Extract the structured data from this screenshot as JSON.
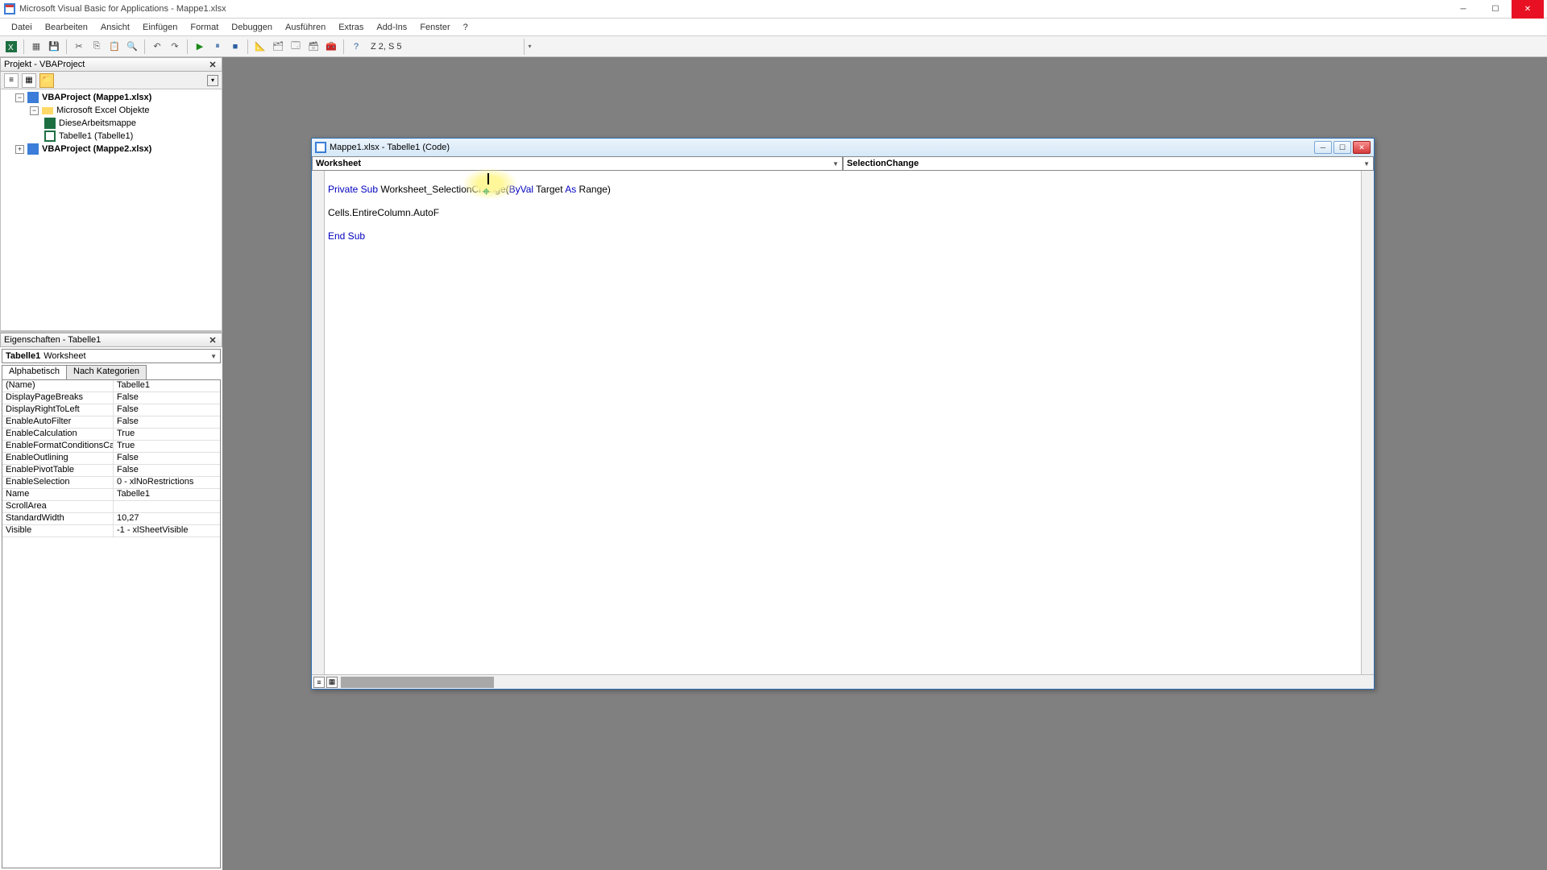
{
  "title": "Microsoft Visual Basic for Applications - Mappe1.xlsx",
  "menu": [
    "Datei",
    "Bearbeiten",
    "Ansicht",
    "Einfügen",
    "Format",
    "Debuggen",
    "Ausführen",
    "Extras",
    "Add-Ins",
    "Fenster",
    "?"
  ],
  "toolbar_pos": "Z 2, S 5",
  "project_panel": {
    "title": "Projekt - VBAProject",
    "tree": {
      "p1": "VBAProject (Mappe1.xlsx)",
      "p1_folder": "Microsoft Excel Objekte",
      "p1_a": "DieseArbeitsmappe",
      "p1_b": "Tabelle1 (Tabelle1)",
      "p2": "VBAProject (Mappe2.xlsx)"
    }
  },
  "props_panel": {
    "title": "Eigenschaften - Tabelle1",
    "combo_name": "Tabelle1",
    "combo_type": "Worksheet",
    "tabs": {
      "a": "Alphabetisch",
      "b": "Nach Kategorien"
    },
    "rows": [
      {
        "n": "(Name)",
        "v": "Tabelle1"
      },
      {
        "n": "DisplayPageBreaks",
        "v": "False"
      },
      {
        "n": "DisplayRightToLeft",
        "v": "False"
      },
      {
        "n": "EnableAutoFilter",
        "v": "False"
      },
      {
        "n": "EnableCalculation",
        "v": "True"
      },
      {
        "n": "EnableFormatConditionsCalc",
        "v": "True"
      },
      {
        "n": "EnableOutlining",
        "v": "False"
      },
      {
        "n": "EnablePivotTable",
        "v": "False"
      },
      {
        "n": "EnableSelection",
        "v": "0 - xlNoRestrictions"
      },
      {
        "n": "Name",
        "v": "Tabelle1"
      },
      {
        "n": "ScrollArea",
        "v": ""
      },
      {
        "n": "StandardWidth",
        "v": "10,27"
      },
      {
        "n": "Visible",
        "v": "-1 - xlSheetVisible"
      }
    ]
  },
  "code_window": {
    "title": "Mappe1.xlsx - Tabelle1 (Code)",
    "object_dd": "Worksheet",
    "proc_dd": "SelectionChange",
    "code": {
      "l1a": "Private Sub",
      "l1b": " Worksheet_SelectionChange(",
      "l1c": "ByVal",
      "l1d": " Target ",
      "l1e": "As",
      "l1f": " Range)",
      "l2": "Cells.EntireColumn.AutoF",
      "l3": "End Sub"
    }
  }
}
